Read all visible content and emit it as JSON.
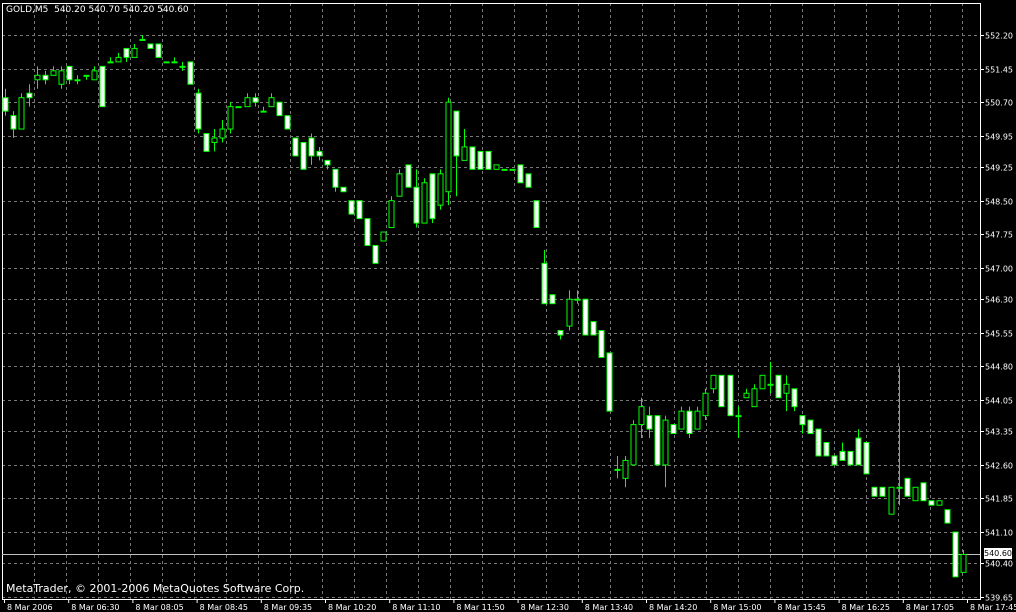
{
  "header": {
    "symbol_timeframe": "GOLD,M5",
    "ohlc": "540.20 540.70 540.20 540.60"
  },
  "footer": {
    "copyright": "MetaTrader, © 2001-2006 MetaQuotes Software Corp."
  },
  "current_price_label": "540.60",
  "colors": {
    "background": "#000000",
    "grid": "#777777",
    "bull_candle": "#000000",
    "bear_candle": "#ffffff",
    "outline": "#00ff00",
    "axis_text": "#ffffff",
    "price_line": "#c0c0c0"
  },
  "chart_data": {
    "type": "candlestick",
    "symbol": "GOLD",
    "timeframe": "M5",
    "grid": true,
    "price_axis_labels": [
      "552.20",
      "551.45",
      "550.70",
      "549.95",
      "549.25",
      "548.50",
      "547.75",
      "547.00",
      "546.30",
      "545.55",
      "544.80",
      "544.05",
      "543.35",
      "542.60",
      "541.85",
      "541.10",
      "540.40",
      "539.65"
    ],
    "time_axis_labels": [
      "8 Mar 2006",
      "8 Mar 06:30",
      "8 Mar 08:05",
      "8 Mar 08:45",
      "8 Mar 09:35",
      "8 Mar 10:20",
      "8 Mar 11:10",
      "8 Mar 11:50",
      "8 Mar 12:30",
      "8 Mar 13:40",
      "8 Mar 14:20",
      "8 Mar 15:00",
      "8 Mar 15:45",
      "8 Mar 16:25",
      "8 Mar 17:05",
      "8 Mar 17:45"
    ],
    "ylim": [
      539.65,
      552.55
    ],
    "last_price": 540.6,
    "candles": [
      [
        550.8,
        551.0,
        550.4,
        550.5
      ],
      [
        550.4,
        550.5,
        549.9,
        550.1
      ],
      [
        550.1,
        550.9,
        550.1,
        550.8
      ],
      [
        550.9,
        551.1,
        550.6,
        550.8
      ],
      [
        551.2,
        551.5,
        551.0,
        551.3
      ],
      [
        551.3,
        551.4,
        551.1,
        551.2
      ],
      [
        551.3,
        551.5,
        551.3,
        551.4
      ],
      [
        551.1,
        551.5,
        551.0,
        551.4
      ],
      [
        551.5,
        551.5,
        551.1,
        551.2
      ],
      [
        551.2,
        551.3,
        551.1,
        551.2
      ],
      [
        551.3,
        551.3,
        551.2,
        551.3
      ],
      [
        551.2,
        551.5,
        551.2,
        551.4
      ],
      [
        551.5,
        551.5,
        550.6,
        550.6
      ],
      [
        551.6,
        551.7,
        551.6,
        551.6
      ],
      [
        551.6,
        551.8,
        551.6,
        551.7
      ],
      [
        551.9,
        551.9,
        551.6,
        551.7
      ],
      [
        551.7,
        552.0,
        551.7,
        551.9
      ],
      [
        552.1,
        552.2,
        552.1,
        552.1
      ],
      [
        552.0,
        552.0,
        551.9,
        551.9
      ],
      [
        552.0,
        552.0,
        551.7,
        551.7
      ],
      [
        551.6,
        551.6,
        551.6,
        551.6
      ],
      [
        551.6,
        551.7,
        551.6,
        551.6
      ],
      [
        551.5,
        551.6,
        551.4,
        551.5
      ],
      [
        551.6,
        551.6,
        551.1,
        551.1
      ],
      [
        550.9,
        551.0,
        550.0,
        550.1
      ],
      [
        550.0,
        550.0,
        549.6,
        549.6
      ],
      [
        549.8,
        550.1,
        549.6,
        549.9
      ],
      [
        549.9,
        550.3,
        549.8,
        550.1
      ],
      [
        550.1,
        550.7,
        550.0,
        550.6
      ],
      [
        550.6,
        550.6,
        550.6,
        550.6
      ],
      [
        550.6,
        550.9,
        550.6,
        550.8
      ],
      [
        550.8,
        550.9,
        550.6,
        550.7
      ],
      [
        550.5,
        550.6,
        550.5,
        550.5
      ],
      [
        550.6,
        550.9,
        550.6,
        550.8
      ],
      [
        550.7,
        550.7,
        550.4,
        550.4
      ],
      [
        550.4,
        550.4,
        550.1,
        550.1
      ],
      [
        549.9,
        549.9,
        549.5,
        549.5
      ],
      [
        549.8,
        549.8,
        549.2,
        549.2
      ],
      [
        549.9,
        550.0,
        549.3,
        549.5
      ],
      [
        549.6,
        549.7,
        549.4,
        549.5
      ],
      [
        549.4,
        549.4,
        549.2,
        549.3
      ],
      [
        549.2,
        549.2,
        548.7,
        548.8
      ],
      [
        548.8,
        548.8,
        548.7,
        548.7
      ],
      [
        548.5,
        548.5,
        548.2,
        548.2
      ],
      [
        548.5,
        548.5,
        548.1,
        548.1
      ],
      [
        548.1,
        548.1,
        547.5,
        547.5
      ],
      [
        547.5,
        547.5,
        547.1,
        547.1
      ],
      [
        547.6,
        547.8,
        547.6,
        547.8
      ],
      [
        547.9,
        548.6,
        547.9,
        548.5
      ],
      [
        548.6,
        549.2,
        548.6,
        549.1
      ],
      [
        549.3,
        549.3,
        548.8,
        548.8
      ],
      [
        548.8,
        549.2,
        547.9,
        548.0
      ],
      [
        548.0,
        549.0,
        548.0,
        548.9
      ],
      [
        549.1,
        549.1,
        548.0,
        548.1
      ],
      [
        548.4,
        549.2,
        548.3,
        549.1
      ],
      [
        548.7,
        550.8,
        548.4,
        550.7
      ],
      [
        550.5,
        550.5,
        548.6,
        549.5
      ],
      [
        549.4,
        550.1,
        549.4,
        549.7
      ],
      [
        549.7,
        549.7,
        549.2,
        549.2
      ],
      [
        549.6,
        549.6,
        549.2,
        549.2
      ],
      [
        549.6,
        549.6,
        549.2,
        549.2
      ],
      [
        549.2,
        549.3,
        549.2,
        549.3
      ],
      [
        549.2,
        549.2,
        549.2,
        549.2
      ],
      [
        549.2,
        549.2,
        549.2,
        549.2
      ],
      [
        549.3,
        549.3,
        548.9,
        548.9
      ],
      [
        549.1,
        549.1,
        548.8,
        548.8
      ],
      [
        548.5,
        548.5,
        547.9,
        547.9
      ],
      [
        547.1,
        547.4,
        546.2,
        546.2
      ],
      [
        546.4,
        546.4,
        546.2,
        546.2
      ],
      [
        545.6,
        545.6,
        545.4,
        545.5
      ],
      [
        545.7,
        546.5,
        545.6,
        546.3
      ],
      [
        546.3,
        546.5,
        546.2,
        546.3
      ],
      [
        546.3,
        546.3,
        545.5,
        545.5
      ],
      [
        545.8,
        545.8,
        545.5,
        545.5
      ],
      [
        545.6,
        545.6,
        545.0,
        545.0
      ],
      [
        545.1,
        545.1,
        543.8,
        543.8
      ],
      [
        542.5,
        542.8,
        542.3,
        542.5
      ],
      [
        542.3,
        542.8,
        542.1,
        542.7
      ],
      [
        542.6,
        543.6,
        542.6,
        543.5
      ],
      [
        543.5,
        544.1,
        543.2,
        543.9
      ],
      [
        543.7,
        543.9,
        543.2,
        543.4
      ],
      [
        543.7,
        543.7,
        542.6,
        542.6
      ],
      [
        542.6,
        543.7,
        542.1,
        543.6
      ],
      [
        543.5,
        543.5,
        543.3,
        543.3
      ],
      [
        543.4,
        543.9,
        543.4,
        543.8
      ],
      [
        543.8,
        543.9,
        543.2,
        543.3
      ],
      [
        543.4,
        543.9,
        543.4,
        543.8
      ],
      [
        543.7,
        544.3,
        543.6,
        544.2
      ],
      [
        544.3,
        544.6,
        544.2,
        544.6
      ],
      [
        544.6,
        544.6,
        543.9,
        543.9
      ],
      [
        544.6,
        544.6,
        543.7,
        543.7
      ],
      [
        543.7,
        543.9,
        543.2,
        543.7
      ],
      [
        544.1,
        544.3,
        544.1,
        544.2
      ],
      [
        543.9,
        544.4,
        543.9,
        544.3
      ],
      [
        544.3,
        544.6,
        544.3,
        544.6
      ],
      [
        544.4,
        544.9,
        544.2,
        544.4
      ],
      [
        544.6,
        544.6,
        544.1,
        544.1
      ],
      [
        544.2,
        544.6,
        543.8,
        544.4
      ],
      [
        544.3,
        544.3,
        543.8,
        543.9
      ],
      [
        543.7,
        543.7,
        543.3,
        543.5
      ],
      [
        543.6,
        543.6,
        543.3,
        543.3
      ],
      [
        543.4,
        543.4,
        542.8,
        542.8
      ],
      [
        543.1,
        543.1,
        542.8,
        542.8
      ],
      [
        542.8,
        542.8,
        542.6,
        542.6
      ],
      [
        542.9,
        543.1,
        542.7,
        542.7
      ],
      [
        542.9,
        542.9,
        542.6,
        542.6
      ],
      [
        543.2,
        543.4,
        542.6,
        542.6
      ],
      [
        543.1,
        543.1,
        542.4,
        542.4
      ],
      [
        542.1,
        542.1,
        541.9,
        541.9
      ],
      [
        542.1,
        542.1,
        541.9,
        541.9
      ],
      [
        541.5,
        542.1,
        541.5,
        542.1
      ],
      [
        542.1,
        544.8,
        541.7,
        542.1
      ],
      [
        542.3,
        542.3,
        541.9,
        541.9
      ],
      [
        541.8,
        542.1,
        541.8,
        542.1
      ],
      [
        542.2,
        542.2,
        541.8,
        541.8
      ],
      [
        541.8,
        541.8,
        541.7,
        541.7
      ],
      [
        541.7,
        541.8,
        541.7,
        541.8
      ],
      [
        541.6,
        541.6,
        541.3,
        541.3
      ],
      [
        541.1,
        541.1,
        540.1,
        540.1
      ],
      [
        540.2,
        540.7,
        540.2,
        540.6
      ]
    ]
  }
}
